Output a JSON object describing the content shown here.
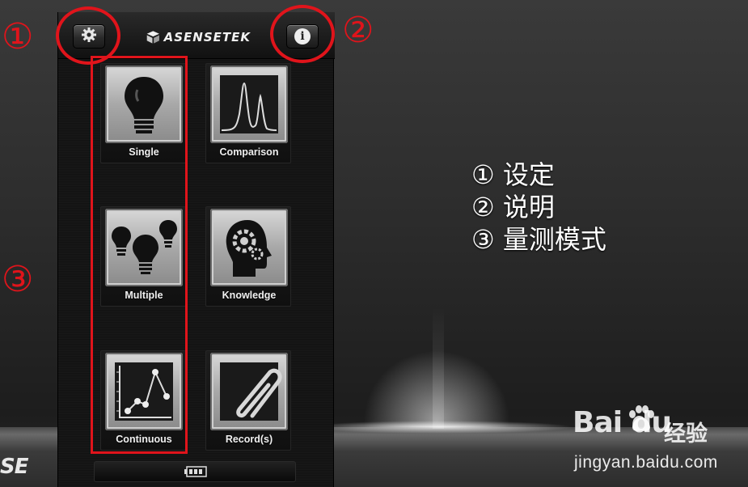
{
  "app": {
    "brand": "ASENSETEK",
    "background_logo": "SE"
  },
  "tiles": [
    {
      "label": "Single",
      "icon": "light-bulb-icon"
    },
    {
      "label": "Comparison",
      "icon": "spectrum-peaks-icon"
    },
    {
      "label": "Multiple",
      "icon": "multiple-bulbs-icon"
    },
    {
      "label": "Knowledge",
      "icon": "head-gears-icon"
    },
    {
      "label": "Continuous",
      "icon": "line-graph-icon"
    },
    {
      "label": "Record(s)",
      "icon": "paperclip-icon"
    }
  ],
  "toolbar": {
    "settings_icon": "gear-icon",
    "info_icon": "info-icon",
    "info_glyph": "i"
  },
  "status": {
    "battery_icon": "battery-icon"
  },
  "annotations": {
    "markers": [
      "①",
      "②",
      "③"
    ],
    "legend": [
      "① 设定",
      "② 说明",
      "③ 量测模式"
    ],
    "color": "#e0141b"
  },
  "watermark": {
    "brand": "Bai du",
    "sub": "经验",
    "url": "jingyan.baidu.com"
  }
}
